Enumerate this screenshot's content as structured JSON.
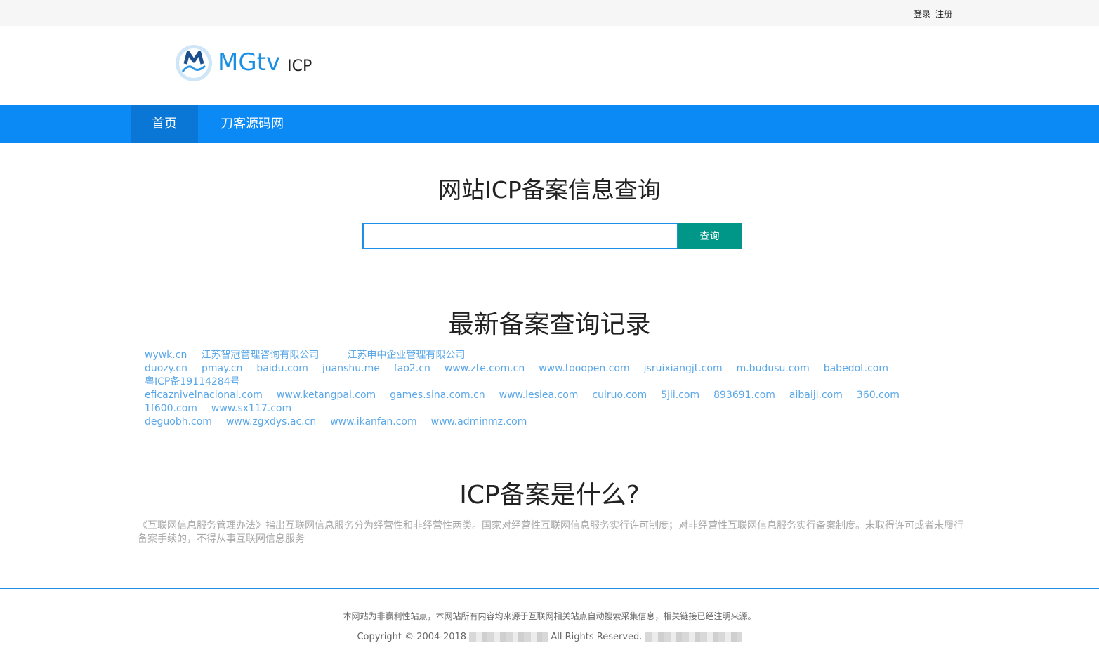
{
  "topbar": {
    "login": "登录",
    "register": "注册"
  },
  "logo": {
    "brand": "MGtv",
    "sub": "ICP"
  },
  "nav": {
    "items": [
      {
        "label": "首页"
      },
      {
        "label": "刀客源码网"
      }
    ]
  },
  "search": {
    "heading": "网站ICP备案信息查询",
    "value": "",
    "button": "查询"
  },
  "records": {
    "heading": "最新备案查询记录",
    "items": [
      "wywk.cn",
      "江苏智冠管理咨询有限公司",
      "江苏申中企业管理有限公司",
      "duozy.cn",
      "pmay.cn",
      "baidu.com",
      "juanshu.me",
      "fao2.cn",
      "www.zte.com.cn",
      "www.tooopen.com",
      "jsruixiangjt.com",
      "m.budusu.com",
      "babedot.com",
      "粤ICP备19114284号",
      "eficaznivelnacional.com",
      "www.ketangpai.com",
      "games.sina.com.cn",
      "www.lesiea.com",
      "cuiruo.com",
      "5jii.com",
      "893691.com",
      "aibaiji.com",
      "360.com",
      "1f600.com",
      "www.sx117.com",
      "deguobh.com",
      "www.zgxdys.ac.cn",
      "www.ikanfan.com",
      "www.adminmz.com"
    ]
  },
  "about": {
    "heading": "ICP备案是什么?",
    "text": "《互联网信息服务管理办法》指出互联网信息服务分为经营性和非经营性两类。国家对经营性互联网信息服务实行许可制度；对非经营性互联网信息服务实行备案制度。未取得许可或者未履行备案手续的，不得从事互联网信息服务"
  },
  "footer": {
    "notice": "本网站为非赢利性站点，本网站所有内容均来源于互联网相关站点自动搜索采集信息，相关链接已经注明来源。",
    "copyright": "Copyright © 2004-2018",
    "rights": "All Rights Reserved."
  },
  "colors": {
    "nav": "#0b8af5",
    "nav_active": "#0a77d6",
    "button": "#009688",
    "link": "#5aa7e8"
  }
}
